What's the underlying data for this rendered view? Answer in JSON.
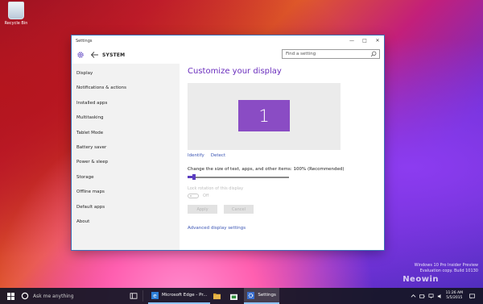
{
  "desktop": {
    "recycle_bin_label": "Recycle Bin",
    "watermark_line1": "Windows 10 Pro Insider Preview",
    "watermark_line2": "Evaluation copy. Build 10130",
    "watermark_logo": "Neowin"
  },
  "window": {
    "title": "Settings",
    "minimize_glyph": "—",
    "maximize_glyph": "□",
    "close_glyph": "✕"
  },
  "navbar": {
    "section_title": "SYSTEM",
    "search_placeholder": "Find a setting"
  },
  "sidebar": {
    "items": [
      {
        "label": "Display"
      },
      {
        "label": "Notifications & actions"
      },
      {
        "label": "Installed apps"
      },
      {
        "label": "Multitasking"
      },
      {
        "label": "Tablet Mode"
      },
      {
        "label": "Battery saver"
      },
      {
        "label": "Power & sleep"
      },
      {
        "label": "Storage"
      },
      {
        "label": "Offline maps"
      },
      {
        "label": "Default apps"
      },
      {
        "label": "About"
      }
    ]
  },
  "main": {
    "heading": "Customize your display",
    "monitor_number": "1",
    "identify_link": "Identify",
    "detect_link": "Detect",
    "scale_label": "Change the size of text, apps, and other items: 100% (Recommended)",
    "scale_level": 0,
    "lock_rotation_label": "Lock rotation of this display",
    "toggle_state": "Off",
    "apply_button": "Apply",
    "cancel_button": "Cancel",
    "advanced_link": "Advanced display settings"
  },
  "taskbar": {
    "search_placeholder": "Ask me anything",
    "apps": [
      {
        "label": "Microsoft Edge - Pr..."
      },
      {
        "label": "Settings"
      }
    ],
    "clock_time": "11:26 AM",
    "clock_date": "5/5/2015"
  },
  "colors": {
    "accent": "#6a2dbd",
    "monitor": "#8a4cc4",
    "link": "#3b55b4",
    "slider": "#5b3ec0"
  }
}
